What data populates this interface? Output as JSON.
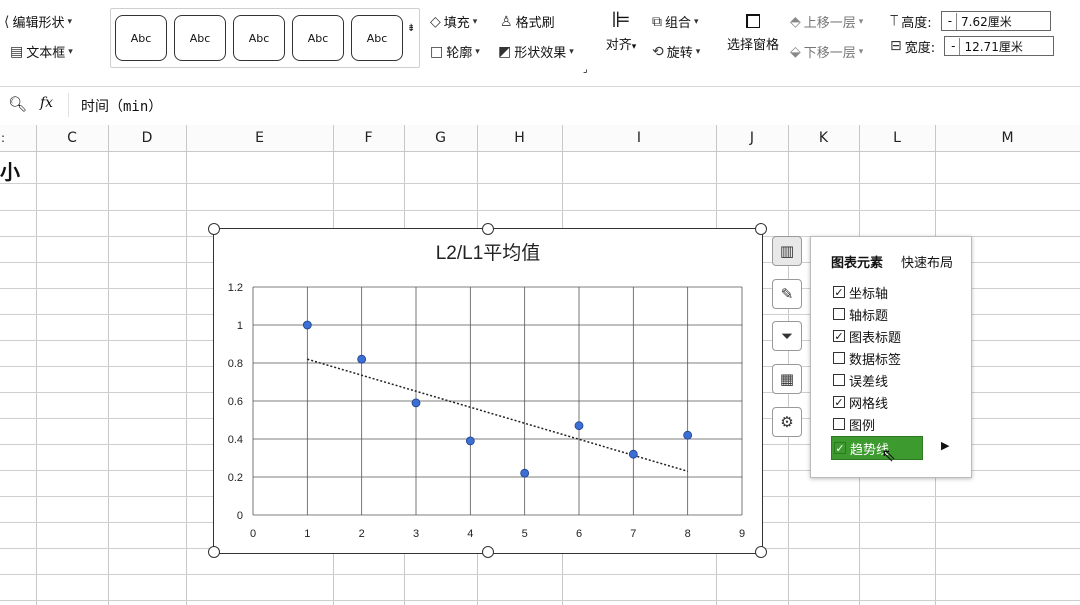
{
  "ribbon": {
    "edit_shape": "编辑形状",
    "text_box": "文本框",
    "style_samples": [
      "Abc",
      "Abc",
      "Abc",
      "Abc",
      "Abc"
    ],
    "fill": "填充",
    "format_painter": "格式刷",
    "outline": "轮廓",
    "shape_effects": "形状效果",
    "align": "对齐",
    "group": "组合",
    "rotate": "旋转",
    "selection_pane": "选择窗格",
    "bring_forward": "上移一层",
    "send_backward": "下移一层",
    "height_label": "高度:",
    "height_value": "7.62厘米",
    "width_label": "宽度:",
    "width_value": "12.71厘米",
    "minus": "-"
  },
  "formula_bar": {
    "fx": "fx",
    "content": "时间（min）"
  },
  "columns": [
    "C",
    "D",
    "E",
    "F",
    "G",
    "H",
    "I",
    "J",
    "K",
    "L",
    "M"
  ],
  "cell_fragment": "小",
  "chart_data": {
    "type": "scatter",
    "title": "L2/L1平均值",
    "xlim": [
      0,
      9
    ],
    "ylim": [
      0,
      1.2
    ],
    "x_ticks": [
      0,
      1,
      2,
      3,
      4,
      5,
      6,
      7,
      8,
      9
    ],
    "y_ticks": [
      0,
      0.2,
      0.4,
      0.6,
      0.8,
      1,
      1.2
    ],
    "series": [
      {
        "x": [
          1,
          2,
          3,
          4,
          5,
          6,
          7,
          8
        ],
        "y": [
          1.0,
          0.82,
          0.59,
          0.39,
          0.22,
          0.47,
          0.32,
          0.42
        ]
      }
    ],
    "trendline": {
      "type": "linear",
      "x": [
        1,
        8
      ],
      "y": [
        0.82,
        0.23
      ]
    },
    "grid": true,
    "colors": {
      "point": "#3b6fd4",
      "trend": "#222222"
    }
  },
  "panel": {
    "tab_elements": "图表元素",
    "tab_quick_layout": "快速布局",
    "items": [
      {
        "label": "坐标轴",
        "checked": true
      },
      {
        "label": "轴标题",
        "checked": false
      },
      {
        "label": "图表标题",
        "checked": true
      },
      {
        "label": "数据标签",
        "checked": false
      },
      {
        "label": "误差线",
        "checked": false
      },
      {
        "label": "网格线",
        "checked": true
      },
      {
        "label": "图例",
        "checked": false
      }
    ],
    "trendline_label": "趋势线",
    "check_glyph": "✓",
    "arrow_glyph": "▶"
  },
  "colors": {
    "highlight": "#3d9a2f"
  }
}
